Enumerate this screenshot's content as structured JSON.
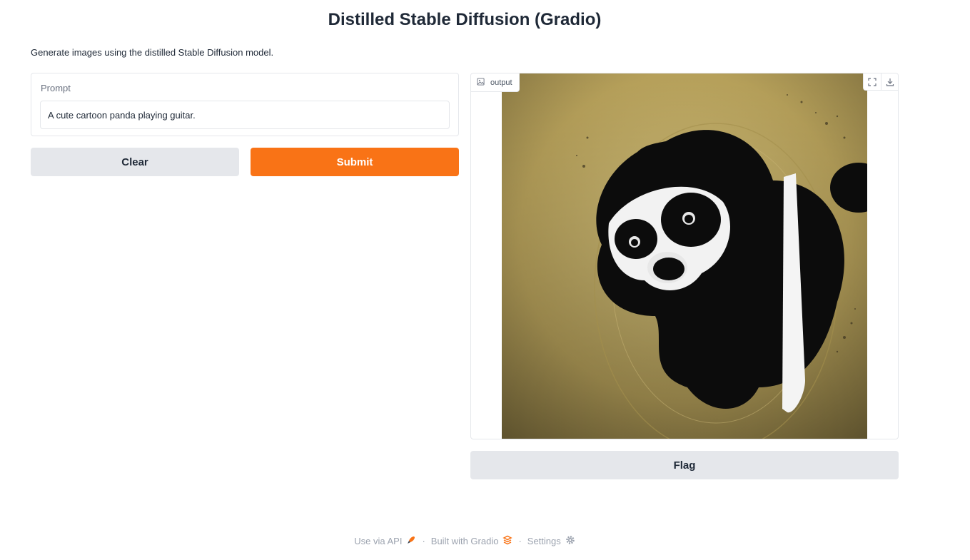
{
  "page": {
    "title": "Distilled Stable Diffusion (Gradio)",
    "description": "Generate images using the distilled Stable Diffusion model."
  },
  "input": {
    "label": "Prompt",
    "value": "A cute cartoon panda playing guitar."
  },
  "buttons": {
    "clear": "Clear",
    "submit": "Submit",
    "flag": "Flag"
  },
  "output": {
    "label": "output",
    "tools": [
      "fullscreen-icon",
      "download-icon"
    ]
  },
  "footer": {
    "api": "Use via API",
    "built": "Built with Gradio",
    "settings": "Settings",
    "separator": "·"
  },
  "colors": {
    "accent": "#f97316",
    "secondary_button": "#e5e7eb",
    "border": "#e5e7eb"
  }
}
